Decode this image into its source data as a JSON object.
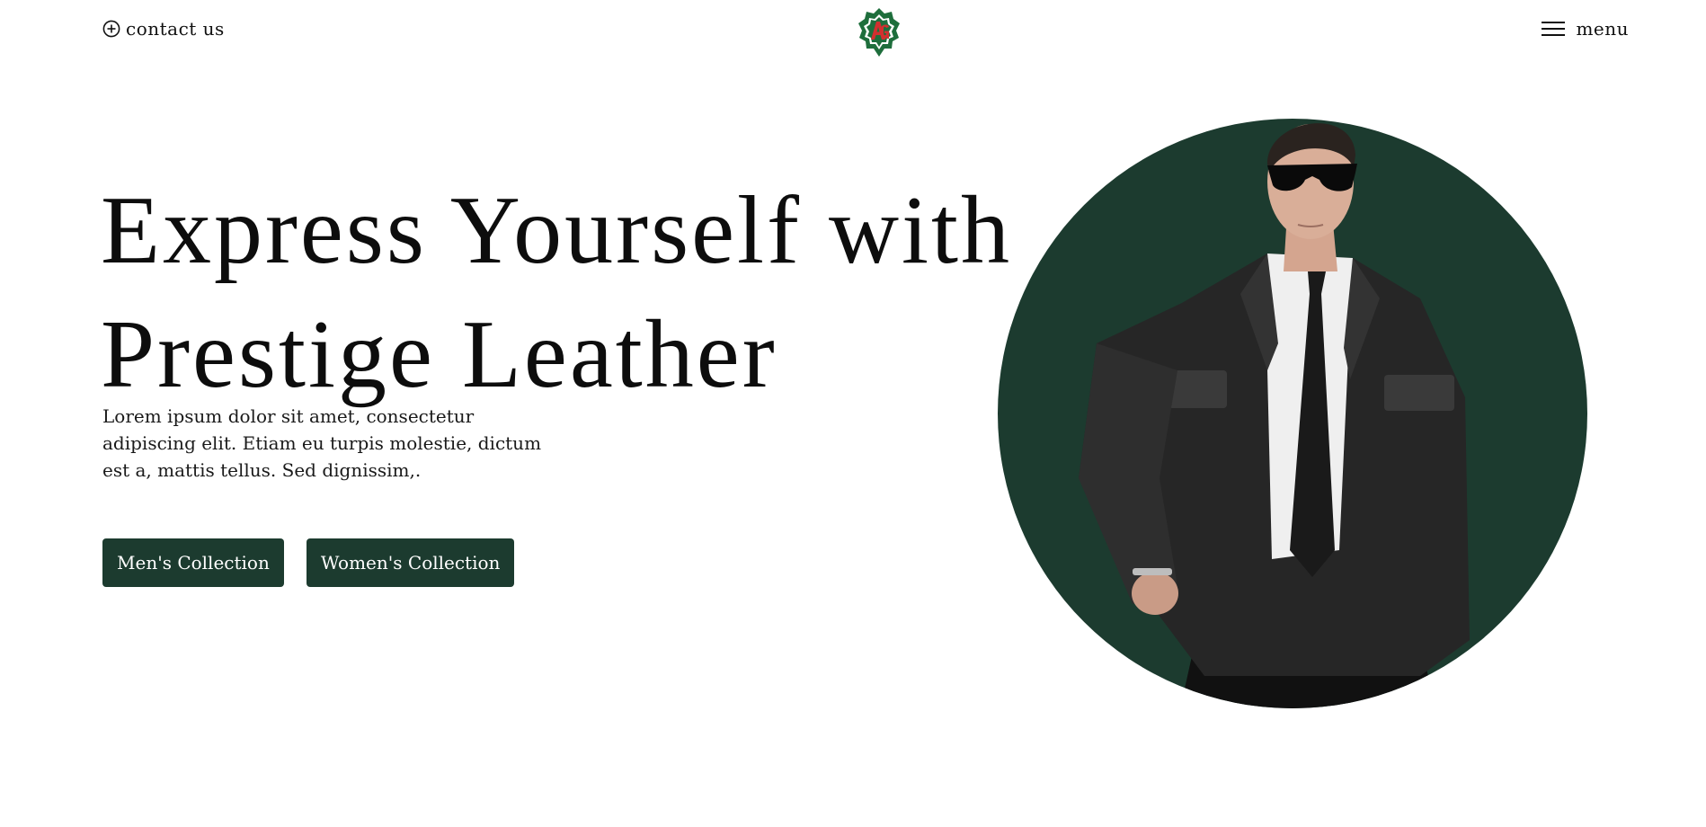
{
  "header": {
    "contact_label": "contact us",
    "contact_icon": "plus-circle-icon",
    "menu_label": "menu",
    "menu_icon": "hamburger-icon",
    "logo_text": "AG"
  },
  "hero": {
    "title_line1": "Express Yourself with",
    "title_line2": "Prestige Leather",
    "description": "Lorem ipsum dolor sit amet, consectetur adipiscing elit. Etiam eu turpis molestie, dictum est a, mattis tellus. Sed dignissim,.",
    "buttons": [
      {
        "label": "Men's Collection"
      },
      {
        "label": "Women's Collection"
      }
    ]
  },
  "colors": {
    "accent": "#1c3b2f",
    "logo_green": "#1e6e3c",
    "logo_red": "#d32f2f",
    "background": "#ffffff",
    "text": "#111111"
  }
}
